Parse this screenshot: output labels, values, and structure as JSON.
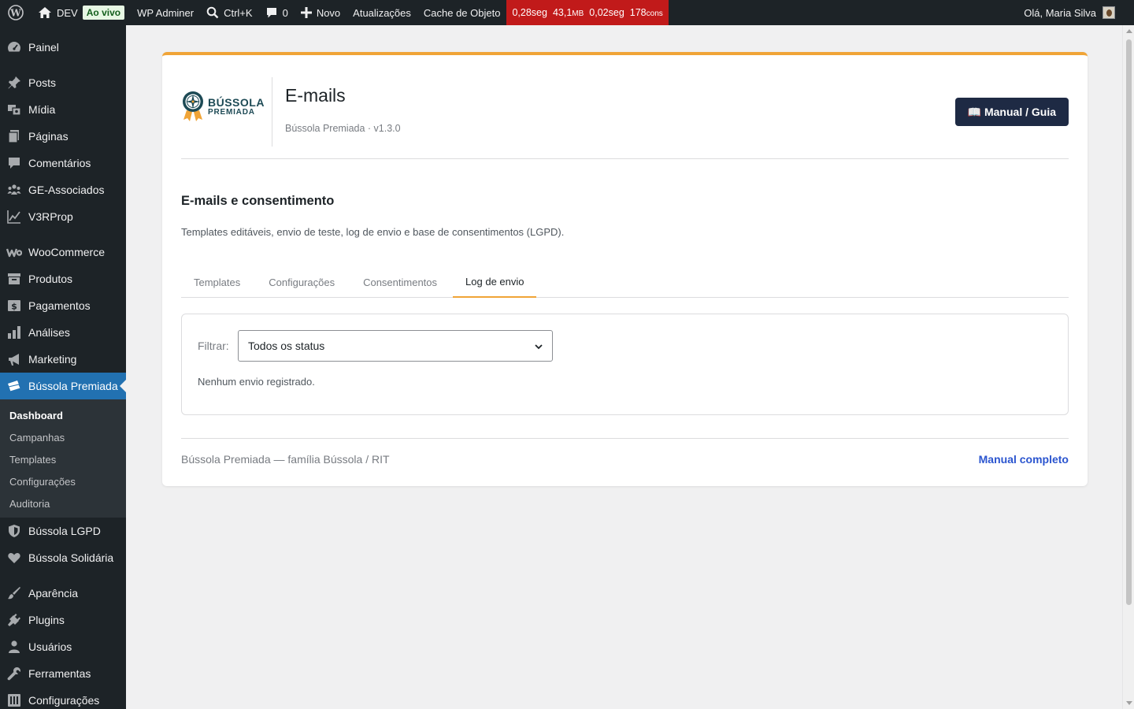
{
  "adminbar": {
    "site_name": "DEV",
    "live_badge": "Ao vivo",
    "adminer": "WP Adminer",
    "search_shortcut": "Ctrl+K",
    "comments_count": "0",
    "new_label": "Novo",
    "updates_label": "Atualizações",
    "cache_label": "Cache de Objeto",
    "perf": {
      "time1": "0,28seg",
      "memory": "43,1",
      "memory_unit": "MB",
      "time2": "0,02seg",
      "queries": "178",
      "queries_unit": "cons"
    },
    "greeting": "Olá, Maria Silva"
  },
  "sidebar": {
    "items": [
      {
        "label": "Painel",
        "icon": "dashboard-icon"
      },
      {
        "label": "Posts",
        "icon": "pin-icon"
      },
      {
        "label": "Mídia",
        "icon": "media-icon"
      },
      {
        "label": "Páginas",
        "icon": "pages-icon"
      },
      {
        "label": "Comentários",
        "icon": "comment-icon"
      },
      {
        "label": "GE-Associados",
        "icon": "groups-icon"
      },
      {
        "label": "V3RProp",
        "icon": "chart-line-icon"
      },
      {
        "label": "WooCommerce",
        "icon": "woo-icon"
      },
      {
        "label": "Produtos",
        "icon": "archive-icon"
      },
      {
        "label": "Pagamentos",
        "icon": "money-icon"
      },
      {
        "label": "Análises",
        "icon": "bar-chart-icon"
      },
      {
        "label": "Marketing",
        "icon": "megaphone-icon"
      },
      {
        "label": "Bússola Premiada",
        "icon": "tickets-icon"
      },
      {
        "label": "Bússola LGPD",
        "icon": "shield-icon"
      },
      {
        "label": "Bússola Solidária",
        "icon": "heart-icon"
      },
      {
        "label": "Aparência",
        "icon": "brush-icon"
      },
      {
        "label": "Plugins",
        "icon": "plugin-icon"
      },
      {
        "label": "Usuários",
        "icon": "user-icon"
      },
      {
        "label": "Ferramentas",
        "icon": "wrench-icon"
      },
      {
        "label": "Configurações",
        "icon": "settings-icon"
      }
    ],
    "submenu": [
      "Dashboard",
      "Campanhas",
      "Templates",
      "Configurações",
      "Auditoria"
    ]
  },
  "header": {
    "logo_line1": "BÚSSOLA",
    "logo_line2": "PREMIADA",
    "title": "E-mails",
    "subtitle": "Bússola Premiada · v1.3.0",
    "manual_button": "📖 Manual / Guia"
  },
  "section": {
    "title": "E-mails e consentimento",
    "description": "Templates editáveis, envio de teste, log de envio e base de consentimentos (LGPD)."
  },
  "tabs": [
    {
      "label": "Templates",
      "active": false
    },
    {
      "label": "Configurações",
      "active": false
    },
    {
      "label": "Consentimentos",
      "active": false
    },
    {
      "label": "Log de envio",
      "active": true
    }
  ],
  "log": {
    "filter_label": "Filtrar:",
    "filter_value": "Todos os status",
    "empty_message": "Nenhum envio registrado."
  },
  "footer": {
    "text": "Bússola Premiada — família Bússola / RIT",
    "link": "Manual completo"
  },
  "colors": {
    "accent": "#f0a437",
    "wp_blue": "#2271b1",
    "admin_dark": "#1d2327",
    "button_dark": "#1e2a44",
    "perf_red": "#c11a1a",
    "link_blue": "#2b55cf"
  }
}
